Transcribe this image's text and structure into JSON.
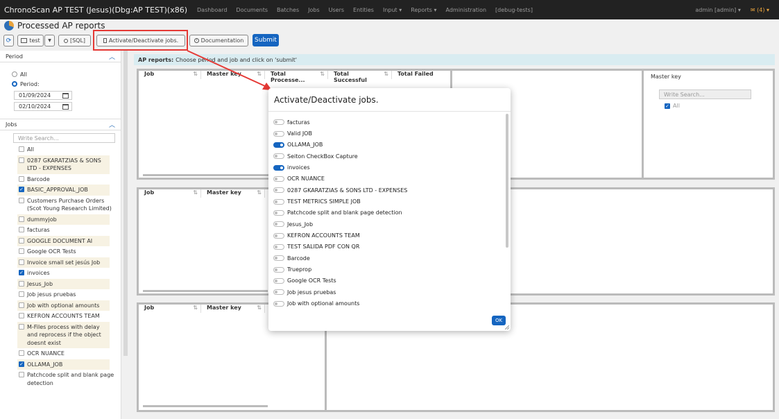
{
  "navbar": {
    "brand": "ChronoScan AP TEST (Jesus)(Dbg:AP TEST)(x86)",
    "items": [
      "Dashboard",
      "Documents",
      "Batches",
      "Jobs",
      "Users",
      "Entities",
      "Input ▾",
      "Reports ▾",
      "Administration",
      "[debug-tests]"
    ],
    "user": "admin [admin] ▾",
    "mail": "✉ (4) ▾"
  },
  "toolbar": {
    "page_title": "Processed AP reports",
    "refresh_label": "⟳",
    "report_select": "test",
    "sql_label": "[SQL]",
    "activate_label": "Activate/Deactivate jobs.",
    "doc_label": "Documentation",
    "submit_label": "Submit"
  },
  "sidebar": {
    "period_title": "Period",
    "radio_all": "All",
    "radio_period": "Period:",
    "date_from": "01/09/2024",
    "date_to": "02/10/2024",
    "jobs_title": "Jobs",
    "search_placeholder": "Write Search...",
    "jobs": [
      {
        "label": "All",
        "checked": false
      },
      {
        "label": "0287 GKARATZIAS & SONS LTD - EXPENSES",
        "checked": false
      },
      {
        "label": "Barcode",
        "checked": false
      },
      {
        "label": "BASIC_APPROVAL_JOB",
        "checked": true
      },
      {
        "label": "Customers Purchase Orders (Scot Young Research Limited)",
        "checked": false
      },
      {
        "label": "dummyjob",
        "checked": false
      },
      {
        "label": "facturas",
        "checked": false
      },
      {
        "label": "GOOGLE DOCUMENT AI",
        "checked": false
      },
      {
        "label": "Google OCR Tests",
        "checked": false
      },
      {
        "label": "Invoice small set jesús Job",
        "checked": false
      },
      {
        "label": "invoices",
        "checked": true
      },
      {
        "label": "Jesus_Job",
        "checked": false
      },
      {
        "label": "Job jesus pruebas",
        "checked": false
      },
      {
        "label": "Job with optional amounts",
        "checked": false
      },
      {
        "label": "KEFRON ACCOUNTS TEAM",
        "checked": false
      },
      {
        "label": "M-Files process with delay and reprocess if the object doesnt exist",
        "checked": false
      },
      {
        "label": "OCR NUANCE",
        "checked": false
      },
      {
        "label": "OLLAMA_JOB",
        "checked": true
      },
      {
        "label": "Patchcode split and blank page detection",
        "checked": false
      }
    ]
  },
  "main": {
    "info_bold": "AP reports:",
    "info_text": "Choose period and job and click on 'submit'",
    "grid1_headers": [
      "Job",
      "Master key",
      "Total Processe...",
      "Total Successful",
      "Total Failed"
    ],
    "grid_headers": [
      "Job",
      "Master key"
    ],
    "masterkey_title": "Master key",
    "masterkey_search": "Write Search...",
    "masterkey_all": "All"
  },
  "modal": {
    "title": "Activate/Deactivate jobs.",
    "ok_label": "OK",
    "jobs": [
      {
        "label": "facturas",
        "on": false
      },
      {
        "label": "Valid JOB",
        "on": false
      },
      {
        "label": "OLLAMA_JOB",
        "on": true
      },
      {
        "label": "Seiton CheckBox Capture",
        "on": false
      },
      {
        "label": "invoices",
        "on": true
      },
      {
        "label": "OCR NUANCE",
        "on": false
      },
      {
        "label": "0287 GKARATZIAS & SONS LTD - EXPENSES",
        "on": false
      },
      {
        "label": "TEST METRICS SIMPLE JOB",
        "on": false
      },
      {
        "label": "Patchcode split and blank page detection",
        "on": false
      },
      {
        "label": "Jesus_Job",
        "on": false
      },
      {
        "label": "KEFRON ACCOUNTS TEAM",
        "on": false
      },
      {
        "label": "TEST SALIDA PDF CON QR",
        "on": false
      },
      {
        "label": "Barcode",
        "on": false
      },
      {
        "label": "Trueprop",
        "on": false
      },
      {
        "label": "Google OCR Tests",
        "on": false
      },
      {
        "label": "Job jesus pruebas",
        "on": false
      },
      {
        "label": "Job with optional amounts",
        "on": false
      }
    ]
  },
  "colors": {
    "accent": "#1565c0",
    "annotation": "#e53935"
  }
}
